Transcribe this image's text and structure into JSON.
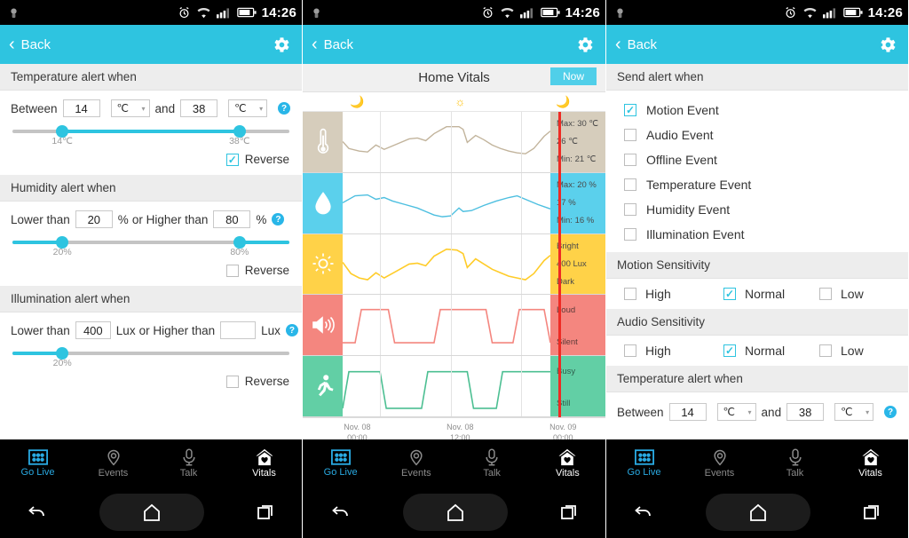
{
  "status_bar": {
    "time": "14:26",
    "icons": [
      "app-icon",
      "alarm-icon",
      "wifi-icon",
      "signal-icon",
      "battery-icon"
    ]
  },
  "header": {
    "back_label": "Back",
    "gear_icon": "gear-icon"
  },
  "colors": {
    "accent": "#2ec4e0",
    "header": "#2ec4e0",
    "now_line": "#ee2b24",
    "temp_band": "#d6cdbc",
    "humidity_band": "#5bd0ec",
    "light_band": "#ffd248",
    "audio_band": "#f4867f",
    "motion_band": "#62cfa5",
    "tab_active": "#29a9e1"
  },
  "panel1": {
    "sections": [
      {
        "title": "Temperature alert when",
        "fields": {
          "prefix": "Between",
          "value1": "14",
          "unit1": "℃",
          "middle": "and",
          "value2": "38",
          "unit2": "℃"
        },
        "slider": {
          "type": "range",
          "left_pct": 18,
          "right_pct": 82,
          "fill": "between",
          "labels": [
            "14℃",
            "38℃"
          ]
        },
        "reverse": {
          "label": "Reverse",
          "checked": true
        }
      },
      {
        "title": "Humidity alert when",
        "fields": {
          "prefix": "Lower than",
          "value1": "20",
          "unit1": "%",
          "middle": "or Higher than",
          "value2": "80",
          "unit2": "%"
        },
        "slider": {
          "type": "range",
          "left_pct": 18,
          "right_pct": 82,
          "fill": "outside",
          "labels": [
            "20%",
            "80%"
          ]
        },
        "reverse": {
          "label": "Reverse",
          "checked": false
        }
      },
      {
        "title": "Illumination alert when",
        "fields": {
          "prefix": "Lower than",
          "value1": "400",
          "unit1": "Lux",
          "middle": "or Higher than",
          "value2": "",
          "unit2": "Lux"
        },
        "slider": {
          "type": "single",
          "left_pct": 18,
          "fill": "left",
          "labels": [
            "20%"
          ]
        },
        "reverse": {
          "label": "Reverse",
          "checked": false
        }
      }
    ],
    "help_glyph": "?"
  },
  "panel2": {
    "title": "Home Vitals",
    "now_button": "Now",
    "daynight": [
      {
        "icon": "moon-icon",
        "pos_pct": 18
      },
      {
        "icon": "sun-icon",
        "pos_pct": 52
      },
      {
        "icon": "moon-icon",
        "pos_pct": 86
      }
    ],
    "now_line_pct": 93
  },
  "panel3": {
    "send_alert": {
      "title": "Send alert when",
      "items": [
        {
          "label": "Motion Event",
          "checked": true
        },
        {
          "label": "Audio Event",
          "checked": false
        },
        {
          "label": "Offline Event",
          "checked": false
        },
        {
          "label": "Temperature Event",
          "checked": false
        },
        {
          "label": "Humidity Event",
          "checked": false
        },
        {
          "label": "Illumination Event",
          "checked": false
        }
      ]
    },
    "motion_sensitivity": {
      "title": "Motion Sensitivity",
      "options": [
        {
          "label": "High",
          "checked": false
        },
        {
          "label": "Normal",
          "checked": true
        },
        {
          "label": "Low",
          "checked": false
        }
      ]
    },
    "audio_sensitivity": {
      "title": "Audio Sensitivity",
      "options": [
        {
          "label": "High",
          "checked": false
        },
        {
          "label": "Normal",
          "checked": true
        },
        {
          "label": "Low",
          "checked": false
        }
      ]
    },
    "temperature": {
      "title": "Temperature alert when",
      "prefix": "Between",
      "value1": "14",
      "unit1": "℃",
      "middle": "and",
      "value2": "38",
      "unit2": "℃"
    }
  },
  "tabbar": {
    "items": [
      {
        "label": "Go Live",
        "icon": "grid-icon",
        "active": true
      },
      {
        "label": "Events",
        "icon": "pin-icon",
        "active": false
      },
      {
        "label": "Talk",
        "icon": "mic-icon",
        "active": false
      },
      {
        "label": "Vitals",
        "icon": "house-heart-icon",
        "active": false
      }
    ]
  },
  "navbar": {
    "back_icon": "nav-back-icon",
    "home_icon": "nav-home-icon",
    "recents_icon": "nav-recents-icon"
  },
  "chart_data": {
    "type": "line",
    "title": "Home Vitals",
    "xlabel": "",
    "grid": true,
    "legend": "none",
    "x_ticks": [
      "Nov. 08\n00:00",
      "Nov. 08\n12:00",
      "Nov. 09\n00:00"
    ],
    "x_tick_positions_pct": [
      18,
      52,
      86
    ],
    "bands": [
      {
        "name": "Temperature",
        "icon": "thermometer-icon",
        "color": "#c2b49c",
        "band_color": "#d6cdbc",
        "unit": "℃",
        "right_labels": [
          "Max:  30   ℃",
          "26  ℃",
          "Min:  21   ℃"
        ],
        "max": 30,
        "current": 26,
        "min": 21,
        "values": [
          24,
          22,
          21.5,
          23,
          22,
          23,
          24,
          25.5,
          26,
          25.5,
          26.5,
          28,
          28,
          28,
          24,
          26,
          25.5,
          24.5,
          23.5,
          22.5,
          22,
          21.5,
          22.5,
          25,
          26
        ]
      },
      {
        "name": "Humidity",
        "icon": "droplet-icon",
        "color": "#4dbfe0",
        "band_color": "#5bd0ec",
        "unit": "%",
        "right_labels": [
          "Max:  20   %",
          "17  %",
          "Min:  16   %"
        ],
        "max": 20,
        "current": 17,
        "min": 16,
        "values": [
          19,
          20,
          20,
          19.5,
          19,
          19.5,
          19,
          18.5,
          18,
          17.5,
          17,
          17,
          16.5,
          16,
          16,
          16.5,
          18,
          17,
          17.5,
          18,
          19,
          19.5,
          20,
          19.5,
          18.5
        ]
      },
      {
        "name": "Illumination",
        "icon": "sun-icon",
        "color": "#ffcc29",
        "band_color": "#ffd248",
        "unit": "Lux",
        "right_labels": [
          "Bright",
          "400 Lux",
          "Dark"
        ],
        "current": 400,
        "values": [
          240,
          150,
          120,
          190,
          160,
          200,
          250,
          300,
          290,
          320,
          360,
          420,
          400,
          410,
          300,
          350,
          310,
          260,
          220,
          180,
          160,
          140,
          180,
          300,
          380
        ]
      },
      {
        "name": "Audio",
        "icon": "speaker-icon",
        "color": "#f4867f",
        "band_color": "#f4867f",
        "unit": "",
        "right_labels": [
          "Loud",
          "Silent"
        ],
        "states": [
          "Silent",
          "Loud",
          "Silent",
          "Loud",
          "Silent",
          "Loud"
        ],
        "square_wave_pct": [
          [
            7,
            20
          ],
          [
            44,
            68
          ],
          [
            80,
            96
          ]
        ]
      },
      {
        "name": "Motion",
        "icon": "runner-icon",
        "color": "#62cfa5",
        "band_color": "#62cfa5",
        "unit": "",
        "right_labels": [
          "Busy",
          "Still"
        ],
        "states": [
          "Still",
          "Busy",
          "Still",
          "Busy",
          "Still",
          "Busy"
        ],
        "square_wave_pct": [
          [
            0,
            16
          ],
          [
            38,
            62
          ],
          [
            76,
            96
          ]
        ]
      }
    ]
  }
}
